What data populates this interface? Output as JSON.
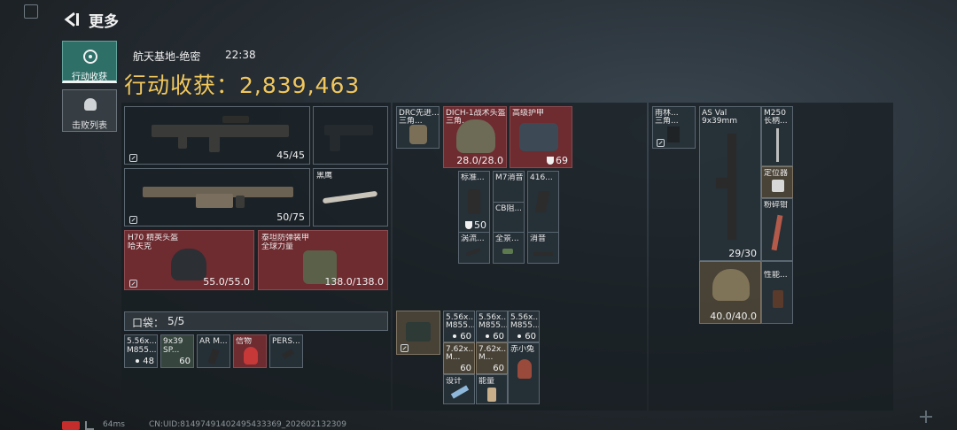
{
  "header": {
    "back_label": "更多"
  },
  "side_tabs": [
    {
      "label": "行动收获"
    },
    {
      "label": "击败列表"
    }
  ],
  "info": {
    "map": "航天基地-绝密",
    "time": "22:38"
  },
  "harvest": {
    "title": "行动收获：",
    "value": "2,839,463"
  },
  "left_slots": {
    "primary1": {
      "ammo": "45/45"
    },
    "primary2": {
      "ammo": "50/75"
    },
    "knife": {
      "name": "黑鹰"
    },
    "helmet": {
      "name": "H70 精英头盔",
      "sub": "哈夫克",
      "durability": "55.0/55.0"
    },
    "armor": {
      "name": "泰坦防弹装甲",
      "sub": "全球力量",
      "durability": "138.0/138.0"
    }
  },
  "pocket": {
    "label": "口袋：",
    "count": "5/5",
    "items": [
      {
        "name": "5.56x...",
        "sub": "M855...",
        "qty": "48"
      },
      {
        "name": "9x39",
        "sub": "SP...",
        "qty": "60"
      },
      {
        "name": "AR M...",
        "sub": "",
        "qty": ""
      },
      {
        "name": "信物",
        "sub": "",
        "qty": ""
      },
      {
        "name": "PERS...",
        "sub": "",
        "qty": ""
      }
    ]
  },
  "rig": {
    "items": [
      {
        "name": "DRC先进...",
        "sub": "三角..."
      },
      {
        "name": "DICH-1战术头盔",
        "sub": "三角...",
        "durability": "28.0/28.0"
      },
      {
        "name": "高级护甲",
        "durability": "69"
      }
    ],
    "attachments": [
      {
        "name": "标准..."
      },
      {
        "name": "M7消音"
      },
      {
        "name": "416..."
      },
      {
        "name": "CB阻..."
      },
      {
        "name": "涡流..."
      },
      {
        "name": "全景..."
      },
      {
        "name": "消音"
      }
    ],
    "helmet_armor_value": "50"
  },
  "backpack": {
    "items": [
      {
        "name": "5.56x...",
        "sub": "M855...",
        "qty": "60"
      },
      {
        "name": "5.56x...",
        "sub": "M855...",
        "qty": "60"
      },
      {
        "name": "5.56x...",
        "sub": "M855...",
        "qty": "60"
      },
      {
        "name": "7.62x...",
        "sub": "M...",
        "qty": "60"
      },
      {
        "name": "7.62x...",
        "sub": "M...",
        "qty": "60"
      },
      {
        "name": "赤小兔",
        "sub": "",
        "qty": ""
      },
      {
        "name": "设计",
        "sub": "",
        "qty": ""
      },
      {
        "name": "能量",
        "sub": "",
        "qty": ""
      }
    ]
  },
  "right": {
    "case": {
      "name": "雨林...",
      "sub": "三角..."
    },
    "weapon": {
      "name": "AS Val",
      "sub": "9x39mm",
      "ammo": "29/30"
    },
    "side_items": [
      {
        "name": "M250",
        "sub": "长柄..."
      },
      {
        "name": "定位器"
      },
      {
        "name": "粉碎钳"
      },
      {
        "name": "性能..."
      }
    ],
    "helmet": {
      "durability": "40.0/40.0"
    }
  },
  "footer": {
    "ping": "64ms",
    "uid": "CN:UID:8149749140249543336​9_202602132309"
  },
  "colors": {
    "accent": "#f1c75c",
    "red_slot": "#6e2b30",
    "tab_active": "#2e6f68"
  }
}
